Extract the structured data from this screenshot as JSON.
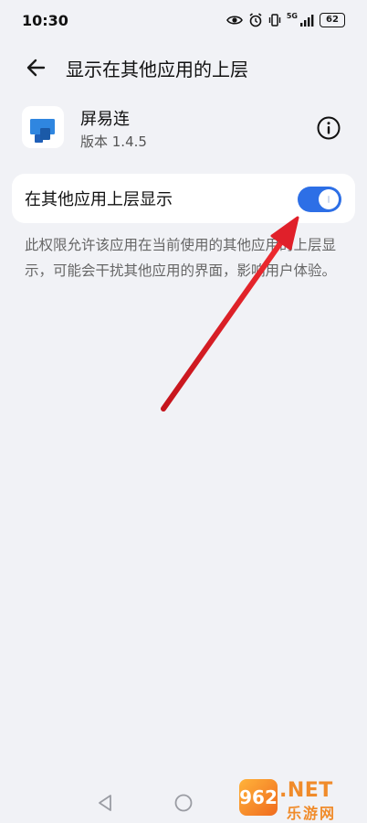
{
  "status_bar": {
    "time": "10:30",
    "network": "5G",
    "battery": "62",
    "icons": [
      "eye-icon",
      "alarm-icon",
      "vibrate-icon",
      "signal-icon",
      "battery-icon"
    ]
  },
  "header": {
    "back_icon": "back-arrow-icon",
    "title": "显示在其他应用的上层"
  },
  "app": {
    "icon": "monitor-app-icon",
    "name": "屏易连",
    "version": "版本 1.4.5",
    "info_icon": "info-icon"
  },
  "permission": {
    "label": "在其他应用上层显示",
    "enabled": true,
    "description": "此权限允许该应用在当前使用的其他应用的上层显示，可能会干扰其他应用的界面，影响用户体验。"
  },
  "colors": {
    "background": "#f1f2f6",
    "toggle_on": "#2d6fe6",
    "annotation_arrow": "#e0202a"
  },
  "nav_bar": {
    "icons": [
      "nav-back-icon",
      "nav-home-icon"
    ]
  },
  "watermark": {
    "logo": "962",
    "text": ".NET",
    "sub": "乐游网"
  }
}
